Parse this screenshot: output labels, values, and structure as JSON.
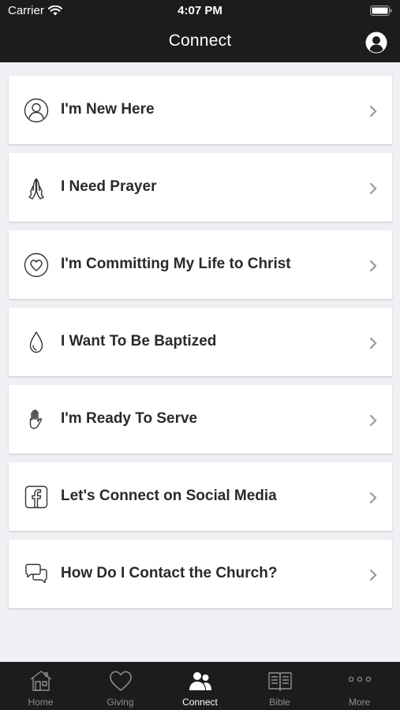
{
  "status_bar": {
    "carrier": "Carrier",
    "time": "4:07 PM"
  },
  "header": {
    "title": "Connect",
    "profile_icon": "user-circle-icon"
  },
  "items": [
    {
      "label": "I'm New Here",
      "icon": "person-circle-icon"
    },
    {
      "label": "I Need Prayer",
      "icon": "praying-hands-icon"
    },
    {
      "label": "I'm Committing My Life to Christ",
      "icon": "heart-circle-icon"
    },
    {
      "label": "I Want To Be Baptized",
      "icon": "water-drop-icon"
    },
    {
      "label": "I'm Ready To Serve",
      "icon": "raised-hand-icon"
    },
    {
      "label": "Let's Connect on Social Media",
      "icon": "facebook-icon"
    },
    {
      "label": "How Do I Contact the Church?",
      "icon": "chat-bubbles-icon"
    }
  ],
  "tabs": [
    {
      "label": "Home",
      "icon": "house-icon",
      "active": false
    },
    {
      "label": "Giving",
      "icon": "heart-icon",
      "active": false
    },
    {
      "label": "Connect",
      "icon": "people-icon",
      "active": true
    },
    {
      "label": "Bible",
      "icon": "open-book-icon",
      "active": false
    },
    {
      "label": "More",
      "icon": "more-dots-icon",
      "active": false
    }
  ],
  "colors": {
    "header_bg": "#1c1c1c",
    "page_bg": "#efeff4",
    "card_bg": "#ffffff",
    "text": "#2a2a2a",
    "tab_inactive": "#8e8e8e",
    "tab_active": "#ffffff"
  }
}
